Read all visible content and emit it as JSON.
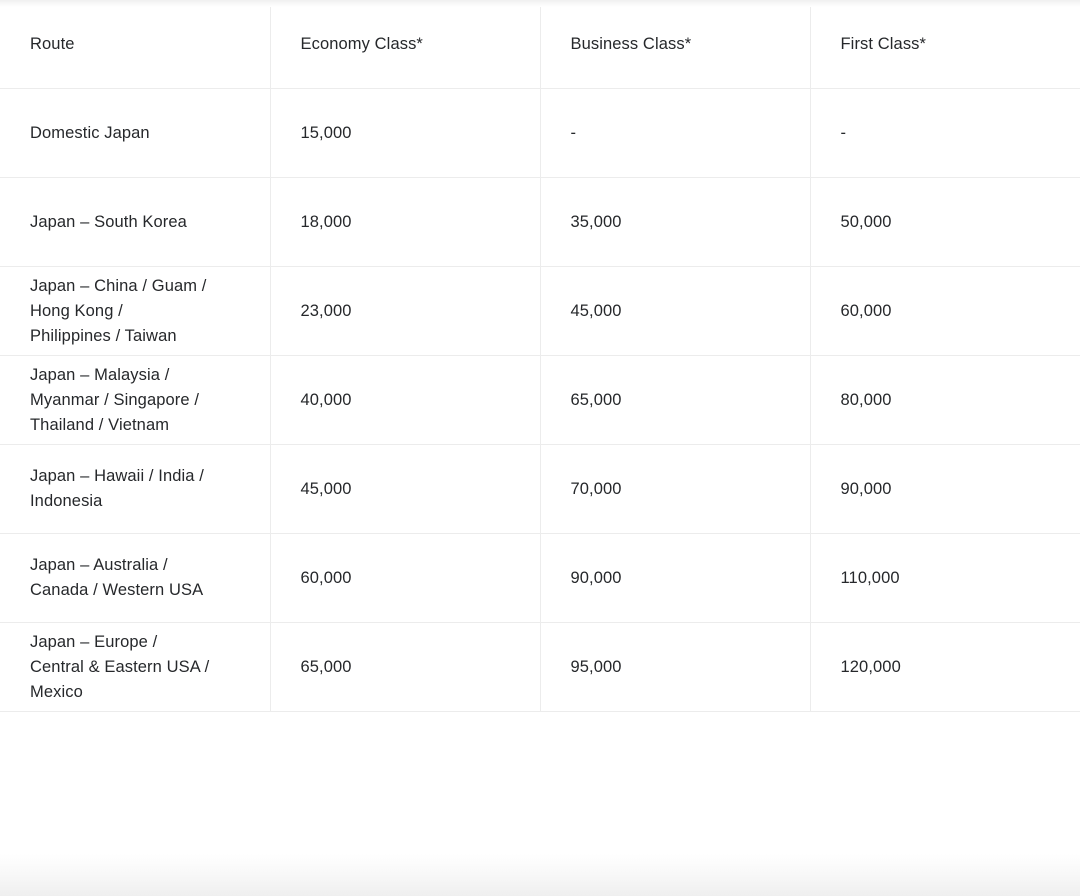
{
  "table": {
    "columns": [
      {
        "key": "route",
        "label": "Route"
      },
      {
        "key": "economy",
        "label": "Economy Class*"
      },
      {
        "key": "business",
        "label": "Business Class*"
      },
      {
        "key": "first",
        "label": "First Class*"
      }
    ],
    "rows": [
      {
        "route": "Domestic Japan",
        "economy": "15,000",
        "business": "-",
        "first": "-",
        "lines": 1
      },
      {
        "route": "Japan – South Korea",
        "economy": "18,000",
        "business": "35,000",
        "first": "50,000",
        "lines": 1
      },
      {
        "route": "Japan – China / Guam /\nHong Kong /\nPhilippines / Taiwan",
        "economy": "23,000",
        "business": "45,000",
        "first": "60,000",
        "lines": 3
      },
      {
        "route": "Japan – Malaysia /\nMyanmar / Singapore /\nThailand / Vietnam",
        "economy": "40,000",
        "business": "65,000",
        "first": "80,000",
        "lines": 3
      },
      {
        "route": "Japan – Hawaii / India /\nIndonesia",
        "economy": "45,000",
        "business": "70,000",
        "first": "90,000",
        "lines": 2
      },
      {
        "route": "Japan – Australia /\nCanada / Western USA",
        "economy": "60,000",
        "business": "90,000",
        "first": "110,000",
        "lines": 2
      },
      {
        "route": "Japan – Europe /\nCentral & Eastern USA /\nMexico",
        "economy": "65,000",
        "business": "95,000",
        "first": "120,000",
        "lines": 3
      }
    ]
  },
  "colors": {
    "text": "#26282b",
    "border": "#ececec",
    "background": "#ffffff"
  }
}
